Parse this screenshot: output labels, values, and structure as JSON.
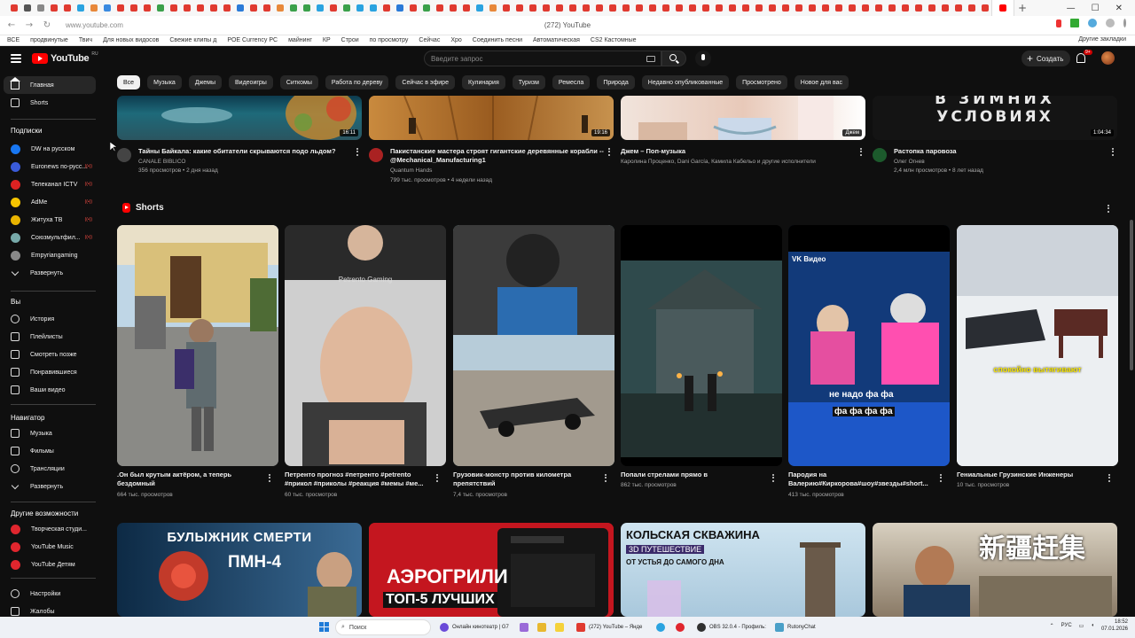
{
  "browser": {
    "window_title": "(272) YouTube",
    "url": "www.youtube.com",
    "bookmarks": [
      "ВСЕ",
      "продвинутые",
      "Твич",
      "Для новых видосов",
      "Свежие клипы д",
      "POE Currency PC",
      "майнинг",
      "КР",
      "Строи",
      "по просмотру",
      "Сейчас",
      "Хро",
      "Соединить песни",
      "Автоматическая",
      "CS2 Кастомные"
    ],
    "bookmarks_right": "Другие закладки"
  },
  "header": {
    "logo_text": "YouTube",
    "logo_region": "RU",
    "search_placeholder": "Введите запрос",
    "create_label": "Создать",
    "notif_count": "9+"
  },
  "sidebar": {
    "main": [
      {
        "label": "Главная",
        "icon": "home-icon"
      },
      {
        "label": "Shorts",
        "icon": "shorts-icon"
      }
    ],
    "subs_heading": "Подписки",
    "subs": [
      {
        "label": "DW на русском",
        "color": "#1877f2"
      },
      {
        "label": "Euronews по-русс...",
        "color": "#3a5bd9"
      },
      {
        "label": "Телеканал ICTV",
        "color": "#d22"
      },
      {
        "label": "AdMe",
        "color": "#f5c400"
      },
      {
        "label": "Житуха ТВ",
        "color": "#e9b400"
      },
      {
        "label": "Союзмультфил...",
        "color": "#7aa"
      },
      {
        "label": "Empyriangaming",
        "color": "#888"
      },
      {
        "label": "Развернуть",
        "color": ""
      }
    ],
    "you_heading": "Вы",
    "you": [
      {
        "label": "История",
        "icon": "history-icon"
      },
      {
        "label": "Плейлисты",
        "icon": "playlist-icon"
      },
      {
        "label": "Смотреть позже",
        "icon": "watch-later-icon"
      },
      {
        "label": "Понравившиеся",
        "icon": "like-icon"
      },
      {
        "label": "Ваши видео",
        "icon": "your-videos-icon"
      }
    ],
    "nav_heading": "Навигатор",
    "nav": [
      {
        "label": "Музыка",
        "icon": "music-icon"
      },
      {
        "label": "Фильмы",
        "icon": "film-icon"
      },
      {
        "label": "Трансляции",
        "icon": "live-icon"
      },
      {
        "label": "Развернуть",
        "icon": "chevron-down-icon"
      }
    ],
    "more_heading": "Другие возможности",
    "more": [
      {
        "label": "Творческая студи...",
        "icon": "studio-icon"
      },
      {
        "label": "YouTube Music",
        "icon": "yt-music-icon"
      },
      {
        "label": "YouTube Детям",
        "icon": "yt-kids-icon"
      }
    ],
    "bottom": [
      {
        "label": "Настройки",
        "icon": "gear-icon"
      },
      {
        "label": "Жалобы",
        "icon": "flag-icon"
      }
    ]
  },
  "chips": [
    "Все",
    "Музыка",
    "Джемы",
    "Видеоигры",
    "Ситкомы",
    "Работа по дереву",
    "Сейчас в эфире",
    "Кулинария",
    "Туризм",
    "Ремесла",
    "Природа",
    "Недавно опубликованные",
    "Просмотрено",
    "Новое для вас"
  ],
  "top_videos": [
    {
      "title": "Тайны Байкала: какие обитатели скрываются подо льдом?",
      "channel": "CANALE BIBLICO",
      "meta": "356 просмотров • 2 дня назад",
      "duration": "16:11"
    },
    {
      "title": "Пакистанские мастера строят гигантские деревянные корабли -- @Mechanical_Manufacturing1",
      "channel": "Quantum Hands",
      "meta": "799 тыс. просмотров • 4 недели назад",
      "duration": "19:16"
    },
    {
      "title": "Джем – Поп-музыка",
      "channel": "Каролина Проценко, Dani García, Камила Кабельо и другие исполнители",
      "meta": "",
      "duration": "Джем"
    },
    {
      "title": "Растопка паровоза",
      "channel": "Олег Огнев",
      "meta": "2,4 млн просмотров • 8 лет назад",
      "duration": "1:04:34",
      "thumb_text1": "В ЗИМНИХ",
      "thumb_text2": "УСЛОВИЯХ"
    }
  ],
  "shorts": {
    "heading": "Shorts",
    "items": [
      {
        "title": ".Он был крутым актёром, а теперь бездомный",
        "meta": "664 тыс. просмотров"
      },
      {
        "title": "Петренто прогноз #петренто #petrento #прикол #приколы #реакция #мемы #ме...",
        "meta": "60 тыс. просмотров",
        "overlay": "Petrento Gaming"
      },
      {
        "title": "Грузовик-монстр против километра препятствий",
        "meta": "7,4 тыс. просмотров"
      },
      {
        "title": "Попали стрелами прямо в",
        "meta": "862 тыс. просмотров"
      },
      {
        "title": "Пародия на Валерию#Киркорова#шоу#звезды#short...",
        "meta": "413 тыс. просмотров",
        "overlay": "VK Видео",
        "caption1": "не надо фа фа",
        "caption2": "фа фа фа фа"
      },
      {
        "title": "Гениальные Грузинские Инженеры",
        "meta": "10 тыс. просмотров",
        "caption1": "спокойно вытягивают"
      }
    ]
  },
  "bottom_videos": [
    {
      "line1": "БУЛЫЖНИК СМЕРТИ",
      "line2": "ПМН-4"
    },
    {
      "line1": "АЭРОГРИЛИ",
      "line2": "ТОП-5 ЛУЧШИХ"
    },
    {
      "line1": "КОЛЬСКАЯ СКВАЖИНА",
      "line2": "3D ПУТЕШЕСТВИЕ",
      "line3": "ОТ УСТЬЯ ДО САМОГО ДНА"
    },
    {
      "line1": "新疆赶集"
    }
  ],
  "taskbar": {
    "search_label": "Поиск",
    "apps": [
      "Онлайн кинотеатр | G7",
      "(272) YouTube – Янде",
      "OBS 32.0.4 - Профиль:",
      "RutonyChat"
    ],
    "lang": "РУС",
    "time": "18:52",
    "date": "07.01.2026"
  },
  "colors": {
    "accent": "#ff0000",
    "bg": "#0f0f0f",
    "chip": "#272727"
  }
}
